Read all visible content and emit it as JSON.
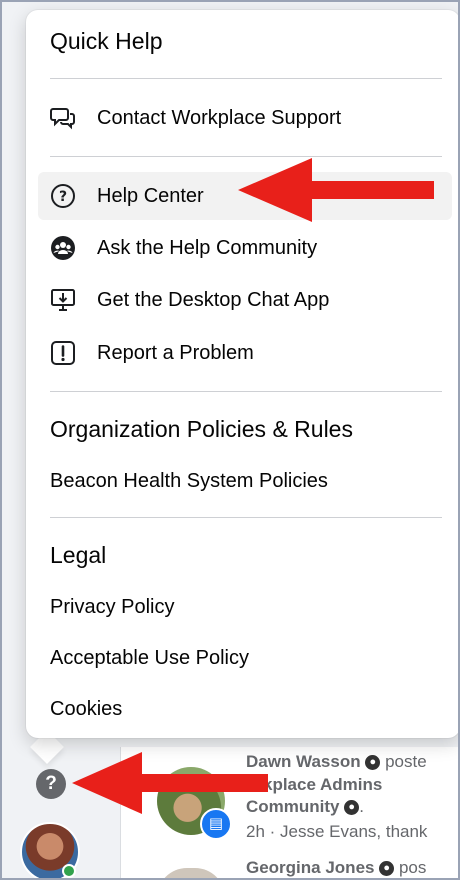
{
  "menu": {
    "quick_help_title": "Quick Help",
    "items": [
      {
        "label": "Contact Workplace Support",
        "icon": "chat-bubbles-icon"
      },
      {
        "label": "Help Center",
        "icon": "question-circle-icon",
        "highlighted": true
      },
      {
        "label": "Ask the Help Community",
        "icon": "community-icon"
      },
      {
        "label": "Get the Desktop Chat App",
        "icon": "desktop-download-icon"
      },
      {
        "label": "Report a Problem",
        "icon": "exclamation-box-icon"
      }
    ],
    "org_title": "Organization Policies & Rules",
    "org_links": [
      "Beacon Health System Policies"
    ],
    "legal_title": "Legal",
    "legal_links": [
      "Privacy Policy",
      "Acceptable Use Policy",
      "Cookies"
    ]
  },
  "feed": {
    "post1_author": "Dawn Wasson",
    "post1_action": "poste",
    "post1_group_line1": "orkplace Admins",
    "post1_group_line2": "Community",
    "post1_meta": "2h · Jesse Evans, thank",
    "post2_author": "Georgina Jones",
    "post2_action": "pos"
  },
  "colors": {
    "arrow": "#e8201a",
    "highlight": "#f2f2f2",
    "accent": "#1877f2"
  }
}
